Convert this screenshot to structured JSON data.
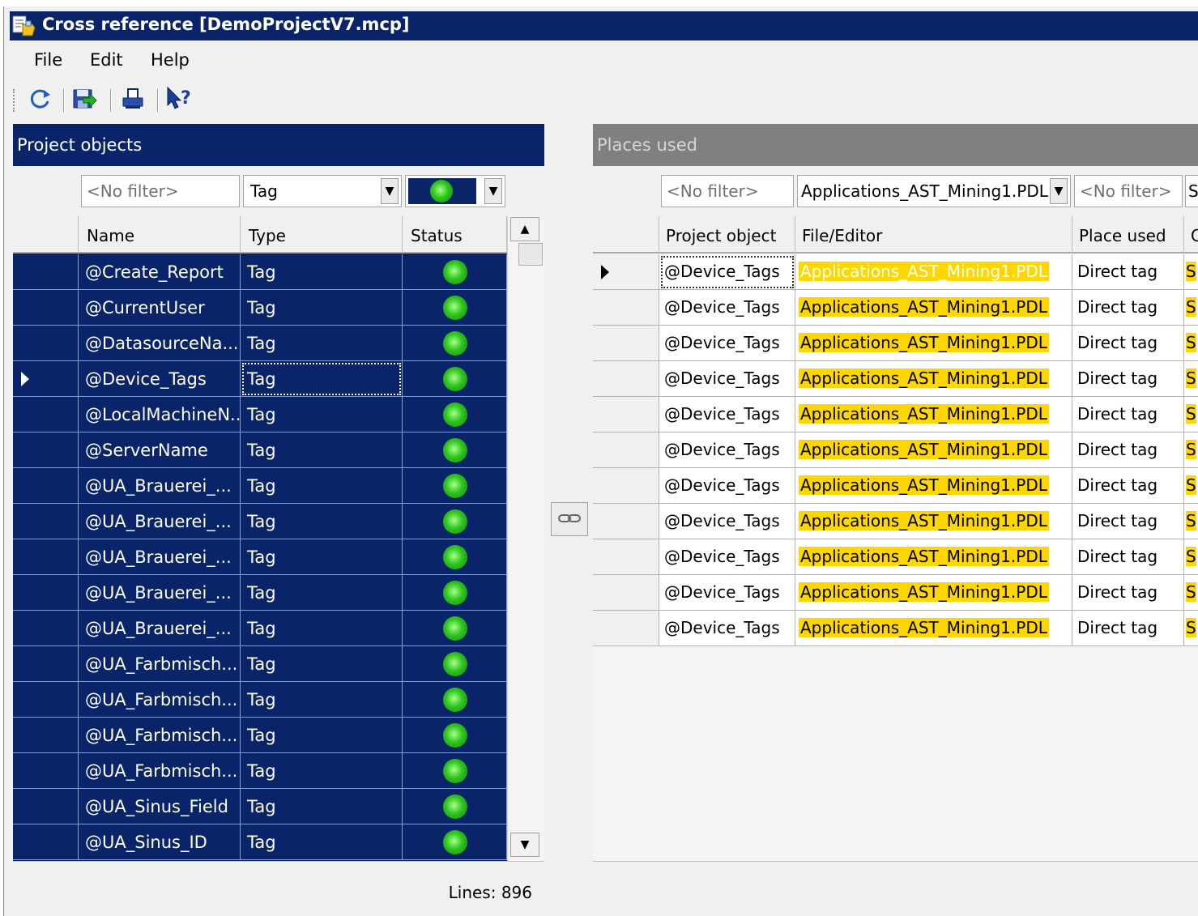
{
  "window": {
    "title": "Cross reference [DemoProjectV7.mcp]",
    "title_icon": "cross-reference-app-icon"
  },
  "menu": [
    "File",
    "Edit",
    "Help"
  ],
  "toolbar": {
    "buttons": [
      {
        "name": "refresh-icon"
      },
      {
        "name": "export-icon"
      },
      {
        "name": "print-icon"
      },
      {
        "name": "whats-this-help-icon"
      }
    ]
  },
  "left_panel": {
    "title": "Project objects",
    "filters": {
      "name_placeholder": "<No filter>",
      "type_value": "Tag",
      "status_value": "green-status-dot"
    },
    "columns": [
      "Name",
      "Type",
      "Status"
    ],
    "rows": [
      {
        "name": "@Create_Report",
        "type": "Tag"
      },
      {
        "name": "@CurrentUser",
        "type": "Tag"
      },
      {
        "name": "@DatasourceNa...",
        "type": "Tag"
      },
      {
        "name": "@Device_Tags",
        "type": "Tag"
      },
      {
        "name": "@LocalMachineN...",
        "type": "Tag"
      },
      {
        "name": "@ServerName",
        "type": "Tag"
      },
      {
        "name": "@UA_Brauerei_...",
        "type": "Tag"
      },
      {
        "name": "@UA_Brauerei_...",
        "type": "Tag"
      },
      {
        "name": "@UA_Brauerei_...",
        "type": "Tag"
      },
      {
        "name": "@UA_Brauerei_...",
        "type": "Tag"
      },
      {
        "name": "@UA_Brauerei_...",
        "type": "Tag"
      },
      {
        "name": "@UA_Farbmisch...",
        "type": "Tag"
      },
      {
        "name": "@UA_Farbmisch...",
        "type": "Tag"
      },
      {
        "name": "@UA_Farbmisch...",
        "type": "Tag"
      },
      {
        "name": "@UA_Farbmisch...",
        "type": "Tag"
      },
      {
        "name": "@UA_Sinus_Field",
        "type": "Tag"
      },
      {
        "name": "@UA_Sinus_ID",
        "type": "Tag"
      }
    ],
    "current_row_index": 3,
    "status_color": "#2ec41c",
    "lines_label": "Lines: 896"
  },
  "right_panel": {
    "title": "Places used",
    "filters": {
      "object_placeholder": "<No filter>",
      "file_value": "Applications_AST_Mining1.PDL",
      "place_placeholder": "<No filter>",
      "partial_next": "S"
    },
    "columns": [
      "Project object",
      "File/Editor",
      "Place used",
      "C"
    ],
    "rows": [
      {
        "object": "@Device_Tags",
        "file": "Applications_AST_Mining1.PDL",
        "place": "Direct tag",
        "extra": "S"
      },
      {
        "object": "@Device_Tags",
        "file": "Applications_AST_Mining1.PDL",
        "place": "Direct tag",
        "extra": "S"
      },
      {
        "object": "@Device_Tags",
        "file": "Applications_AST_Mining1.PDL",
        "place": "Direct tag",
        "extra": "S"
      },
      {
        "object": "@Device_Tags",
        "file": "Applications_AST_Mining1.PDL",
        "place": "Direct tag",
        "extra": "S"
      },
      {
        "object": "@Device_Tags",
        "file": "Applications_AST_Mining1.PDL",
        "place": "Direct tag",
        "extra": "S"
      },
      {
        "object": "@Device_Tags",
        "file": "Applications_AST_Mining1.PDL",
        "place": "Direct tag",
        "extra": "S"
      },
      {
        "object": "@Device_Tags",
        "file": "Applications_AST_Mining1.PDL",
        "place": "Direct tag",
        "extra": "S"
      },
      {
        "object": "@Device_Tags",
        "file": "Applications_AST_Mining1.PDL",
        "place": "Direct tag",
        "extra": "S"
      },
      {
        "object": "@Device_Tags",
        "file": "Applications_AST_Mining1.PDL",
        "place": "Direct tag",
        "extra": "S"
      },
      {
        "object": "@Device_Tags",
        "file": "Applications_AST_Mining1.PDL",
        "place": "Direct tag",
        "extra": "S"
      },
      {
        "object": "@Device_Tags",
        "file": "Applications_AST_Mining1.PDL",
        "place": "Direct tag",
        "extra": "S"
      }
    ],
    "current_row_index": 0,
    "highlight_color": "#ffd700"
  },
  "colors": {
    "title_bar": "#0a246a",
    "selection": "#0a246a",
    "inactive_header": "#808080"
  },
  "splitter": {
    "link_icon": "link-chain-icon"
  }
}
